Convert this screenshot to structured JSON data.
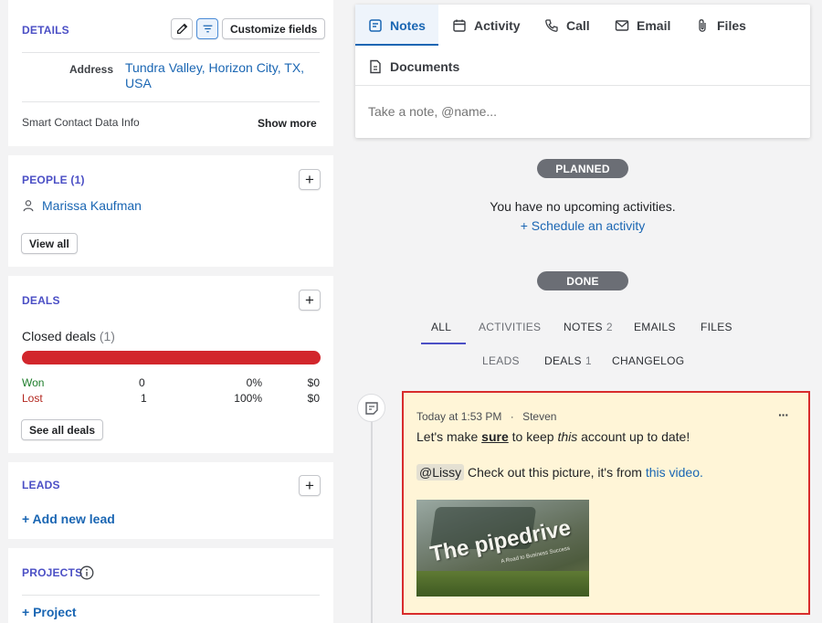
{
  "details": {
    "title": "DETAILS",
    "customize_label": "Customize fields",
    "address_label": "Address",
    "address_value": "Tundra Valley, Horizon City, TX, USA",
    "smart_info": "Smart Contact Data Info",
    "show_more": "Show more"
  },
  "people": {
    "title": "PEOPLE (1)",
    "person": "Marissa Kaufman",
    "view_all": "View all"
  },
  "deals": {
    "title": "DEALS",
    "closed_label": "Closed deals",
    "closed_count": "(1)",
    "won_fraction": 0,
    "rows": [
      {
        "label": "Won",
        "count": "0",
        "percent": "0%",
        "amount": "$0",
        "color": "#1d7d2a"
      },
      {
        "label": "Lost",
        "count": "1",
        "percent": "100%",
        "amount": "$0",
        "color": "#b3261e"
      }
    ],
    "see_all": "See all deals"
  },
  "leads": {
    "title": "LEADS",
    "add": "+ Add new lead"
  },
  "projects": {
    "title": "PROJECTS",
    "add": "+ Project"
  },
  "composer": {
    "tabs": [
      {
        "label": "Notes",
        "icon": "notes-icon",
        "active": true
      },
      {
        "label": "Activity",
        "icon": "calendar-icon"
      },
      {
        "label": "Call",
        "icon": "phone-icon"
      },
      {
        "label": "Email",
        "icon": "envelope-icon"
      },
      {
        "label": "Files",
        "icon": "paperclip-icon"
      },
      {
        "label": "Documents",
        "icon": "document-icon"
      }
    ],
    "placeholder": "Take a note, @name..."
  },
  "planned": {
    "pill": "PLANNED",
    "empty": "You have no upcoming activities.",
    "schedule": "+ Schedule an activity"
  },
  "done": {
    "pill": "DONE"
  },
  "filters": {
    "row1": [
      {
        "label": "ALL",
        "count": ""
      },
      {
        "label": "ACTIVITIES",
        "count": ""
      },
      {
        "label": "NOTES",
        "count": "2"
      },
      {
        "label": "EMAILS",
        "count": ""
      },
      {
        "label": "FILES",
        "count": ""
      }
    ],
    "row2": [
      {
        "label": "LEADS",
        "count": ""
      },
      {
        "label": "DEALS",
        "count": "1"
      },
      {
        "label": "CHANGELOG",
        "count": ""
      }
    ]
  },
  "note": {
    "timestamp": "Today at 1:53 PM",
    "separator": "·",
    "author": "Steven",
    "more": "···",
    "line1_a": "Let's make ",
    "line1_b": "sure",
    "line1_c": " to keep ",
    "line1_d": "this",
    "line1_e": " account up to date!",
    "mention": "@Lissy",
    "line2_a": " Check out this picture, it's from ",
    "line2_link": "this video.",
    "thumb_title": "The pipedrive",
    "thumb_sub": "A Road to Business Success"
  },
  "colors": {
    "accent": "#4b4fc5",
    "link": "#1a66b3",
    "highlight_border": "#d82c2c",
    "note_bg": "#fff5d7",
    "lost_bar": "#d2262c"
  }
}
